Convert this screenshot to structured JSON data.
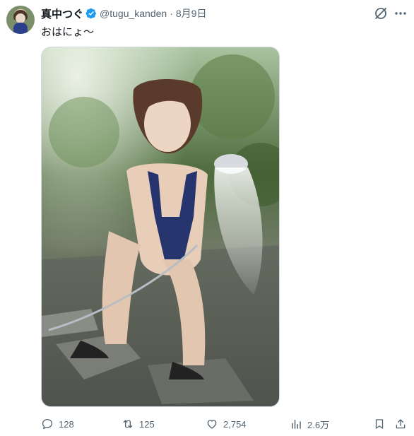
{
  "author": {
    "display_name": "真中つぐ",
    "handle": "@tugu_kanden",
    "date": "8月9日",
    "separator": "·"
  },
  "tweet": {
    "text": "おはにょ～"
  },
  "icons": {
    "verified": "verified-badge-icon",
    "grok": "grok-icon",
    "more": "more-icon",
    "reply": "reply-icon",
    "repost": "repost-icon",
    "like": "heart-icon",
    "views": "views-chart-icon",
    "bookmark": "bookmark-icon",
    "share": "share-icon"
  },
  "stats": {
    "replies": "128",
    "reposts": "125",
    "likes": "2,754",
    "views": "2.6万"
  },
  "colors": {
    "verified_blue": "#1d9bf0",
    "secondary_text": "#536471",
    "primary_text": "#0f1419"
  }
}
